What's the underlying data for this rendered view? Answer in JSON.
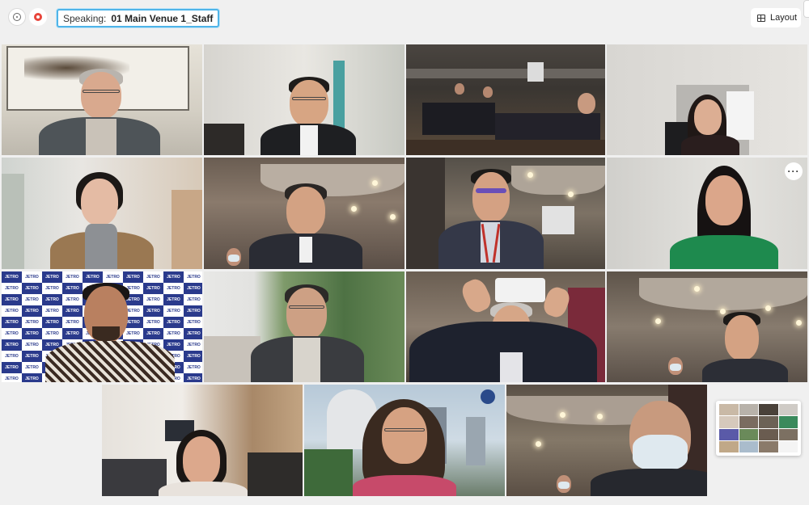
{
  "toolbar": {
    "info_icon": "info-circle-icon",
    "record_icon": "record-icon",
    "speaking_label": "Speaking:",
    "speaking_name": "01 Main Venue 1_Staff",
    "layout_label": "Layout",
    "layout_icon": "grid-icon"
  },
  "tile_menu": {
    "label": "···"
  },
  "tiles": [
    {
      "id": "tile-1",
      "desc": "older man with glasses in office"
    },
    {
      "id": "tile-2",
      "desc": "man with glasses in office"
    },
    {
      "id": "tile-3",
      "desc": "conference hall with seated attendees"
    },
    {
      "id": "tile-4",
      "desc": "woman in dark room"
    },
    {
      "id": "tile-5",
      "desc": "woman with grey turtleneck"
    },
    {
      "id": "tile-6",
      "desc": "man in suit at venue"
    },
    {
      "id": "tile-7",
      "desc": "man with glasses and lanyard at venue"
    },
    {
      "id": "tile-8",
      "desc": "woman in green dress"
    },
    {
      "id": "tile-9",
      "desc": "man in front of backdrop"
    },
    {
      "id": "tile-10",
      "desc": "man with glasses outdoors"
    },
    {
      "id": "tile-11",
      "desc": "man holding phone at venue"
    },
    {
      "id": "tile-12",
      "desc": "man at venue with lights"
    },
    {
      "id": "tile-13",
      "desc": "woman in modern room"
    },
    {
      "id": "tile-14",
      "desc": "woman with city background"
    },
    {
      "id": "tile-15",
      "desc": "man with face mask at venue"
    }
  ],
  "backdrop_text": "JETRO",
  "colors": {
    "accent": "#4fb4e8",
    "record": "#e8443a",
    "background": "#f0f0f0"
  }
}
